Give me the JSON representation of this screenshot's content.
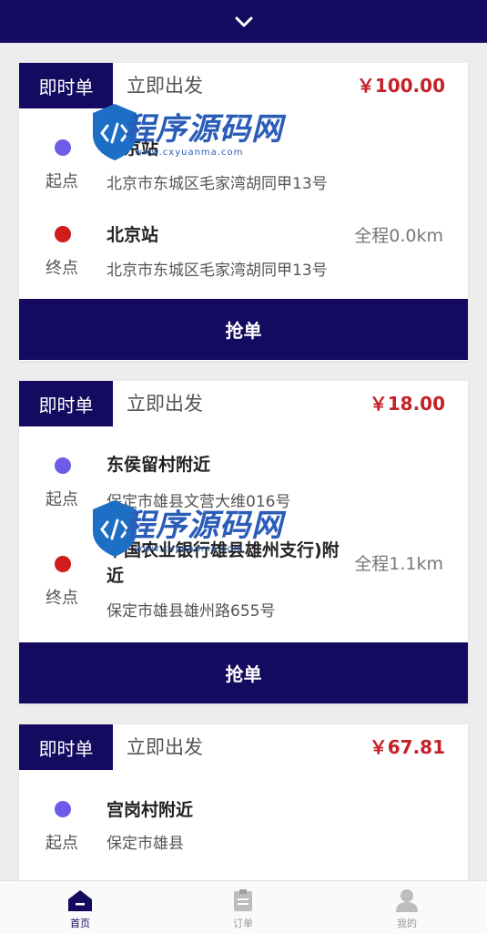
{
  "orders": [
    {
      "tag": "即时单",
      "depart": "立即出发",
      "price": "￥100.00",
      "start": {
        "label": "起点",
        "name": "北京站",
        "address": "北京市东城区毛家湾胡同甲13号"
      },
      "end": {
        "label": "终点",
        "name": "北京站",
        "address": "北京市东城区毛家湾胡同甲13号"
      },
      "distance": "全程0.0km",
      "action": "抢单"
    },
    {
      "tag": "即时单",
      "depart": "立即出发",
      "price": "￥18.00",
      "start": {
        "label": "起点",
        "name": "东侯留村附近",
        "address": "保定市雄县文营大维016号"
      },
      "end": {
        "label": "终点",
        "name": "中国农业银行雄县雄州支行)附近",
        "address": "保定市雄县雄州路655号"
      },
      "distance": "全程1.1km",
      "action": "抢单"
    },
    {
      "tag": "即时单",
      "depart": "立即出发",
      "price": "￥67.81",
      "start": {
        "label": "起点",
        "name": "宫岗村附近",
        "address": "保定市雄县"
      }
    }
  ],
  "tabbar": [
    {
      "label": "首页",
      "icon": "home-icon"
    },
    {
      "label": "订单",
      "icon": "clipboard-icon"
    },
    {
      "label": "我的",
      "icon": "user-icon"
    }
  ],
  "watermark": {
    "text": "程序源码网",
    "url": "www.cxyuanma.com"
  },
  "colors": {
    "primary": "#140a60",
    "price": "#c42127",
    "start_dot": "#6c5ce7",
    "end_dot": "#d01c1c"
  }
}
